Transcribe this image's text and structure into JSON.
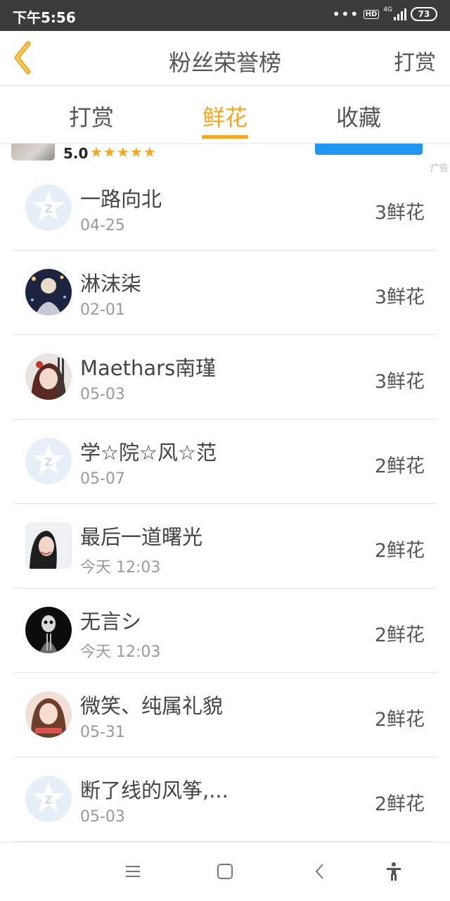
{
  "status_bar": {
    "time": "下午5:56",
    "hd": "HD",
    "network": "4G",
    "battery": "73"
  },
  "header": {
    "back_icon": "back-chevron-icon",
    "title": "粉丝荣誉榜",
    "action_label": "打赏"
  },
  "tabs": [
    {
      "label": "打赏",
      "active": false
    },
    {
      "label": "鲜花",
      "active": true
    },
    {
      "label": "收藏",
      "active": false
    }
  ],
  "ad": {
    "rating": "5.0",
    "stars": "★★★★★",
    "ad_label": "广告"
  },
  "list": [
    {
      "name": "一路向北",
      "date": "04-25",
      "count": "3鲜花",
      "avatar": "default-qq-avatar"
    },
    {
      "name": "淋沫柒",
      "date": "02-01",
      "count": "3鲜花",
      "avatar": "anime-avatar"
    },
    {
      "name": "Maethars南瑾",
      "date": "05-03",
      "count": "3鲜花",
      "avatar": "anime-girl-avatar"
    },
    {
      "name": "学☆院☆风☆范",
      "date": "05-07",
      "count": "2鲜花",
      "avatar": "default-qq-avatar"
    },
    {
      "name": "最后一道曙光",
      "date": "今天 12:03",
      "count": "2鲜花",
      "avatar": "photo-avatar"
    },
    {
      "name": "无言シ",
      "date": "今天 12:03",
      "count": "2鲜花",
      "avatar": "dark-avatar"
    },
    {
      "name": "微笑、纯属礼貌",
      "date": "05-31",
      "count": "2鲜花",
      "avatar": "photo-girl-avatar"
    },
    {
      "name": "断了线的风筝,...",
      "date": "05-03",
      "count": "2鲜花",
      "avatar": "default-qq-avatar"
    }
  ],
  "nav_bar": {
    "icons": [
      "menu-icon",
      "home-icon",
      "back-icon",
      "accessibility-icon"
    ]
  },
  "colors": {
    "accent": "#f5a623",
    "ad_button": "#2196f3",
    "status_bar": "#3b3b3b"
  }
}
